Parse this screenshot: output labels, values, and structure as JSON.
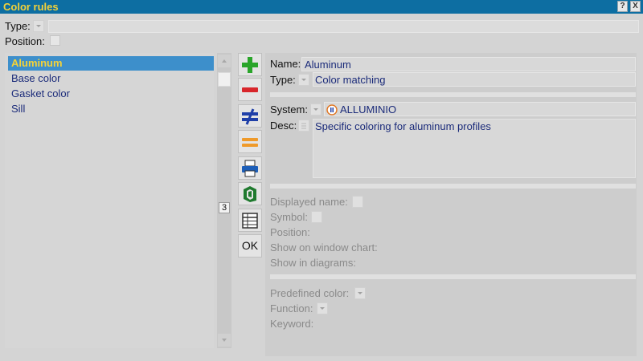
{
  "window": {
    "title": "Color rules",
    "help_label": "?",
    "close_label": "X"
  },
  "top": {
    "type_label": "Type:",
    "position_label": "Position:"
  },
  "list": {
    "items": [
      "Aluminum",
      "Base color",
      "Gasket color",
      "Sill"
    ],
    "selected": 0,
    "count": "3"
  },
  "toolbar": {
    "add": "add-icon",
    "remove": "remove-icon",
    "not_equal": "not-equal-icon",
    "equal": "equal-icon",
    "print": "printer-icon",
    "profile": "profile-icon",
    "table": "table-icon",
    "ok_label": "OK"
  },
  "details": {
    "name_label": "Name:",
    "name_value": "Aluminum",
    "type_label": "Type:",
    "type_value": "Color matching",
    "system_label": "System:",
    "system_value": "ALLUMINIO",
    "desc_label": "Desc:",
    "desc_value": "Specific coloring for aluminum profiles"
  },
  "disabled": {
    "displayed_name": "Displayed name:",
    "symbol": "Symbol:",
    "position": "Position:",
    "show_window_chart": "Show on window chart:",
    "show_diagrams": "Show in diagrams:",
    "predefined_color": "Predefined color:",
    "function": "Function:",
    "keyword": "Keyword:"
  },
  "colors": {
    "titlebar": "#0d6ea2",
    "title_text": "#f4d238",
    "selection": "#3d8fcb",
    "list_text": "#1b2b7a",
    "add_green": "#2aa52a",
    "remove_red": "#d8262b",
    "not_equal_blue": "#1f3fa8",
    "equal_orange": "#ef9a2a"
  }
}
